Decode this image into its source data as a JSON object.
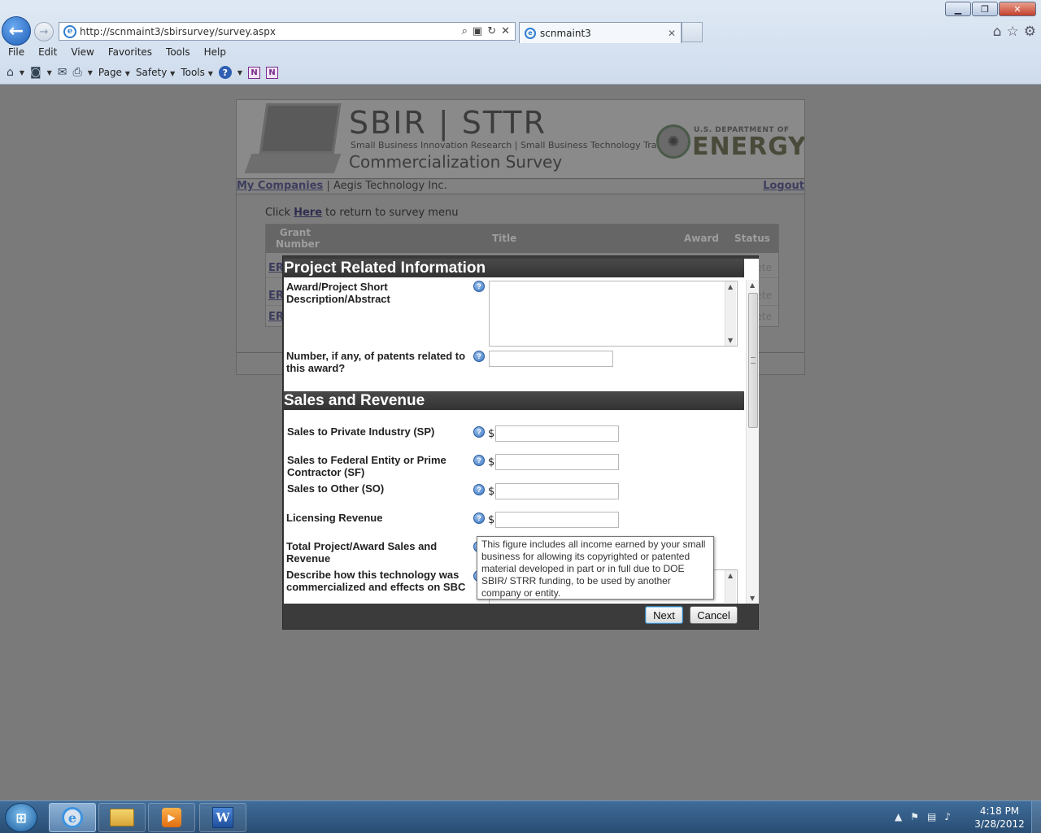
{
  "browser": {
    "url": "http://scnmaint3/sbirsurvey/survey.aspx",
    "tab_title": "scnmaint3",
    "menu": [
      "File",
      "Edit",
      "View",
      "Favorites",
      "Tools",
      "Help"
    ],
    "command_bar": {
      "page": "Page",
      "safety": "Safety",
      "tools": "Tools"
    },
    "window_controls": {
      "minimize": "▁",
      "maximize": "❐",
      "close": "✕"
    }
  },
  "banner": {
    "title": "SBIR | STTR",
    "subtitle": "Small Business Innovation Research | Small Business Technology Transfer",
    "survey": "Commercialization Survey",
    "doe_small": "U.S. DEPARTMENT OF",
    "doe_big": "ENERGY"
  },
  "company_bar": {
    "my_companies": "My Companies",
    "separator": " | ",
    "company_name": "Aegis Technology Inc.",
    "logout": "Logout"
  },
  "return_line": {
    "prefix": "Click ",
    "link": "Here",
    "suffix": " to return to survey menu"
  },
  "grant_table": {
    "headers": {
      "grant": "Grant Number",
      "title": "Title",
      "award": "Award",
      "status": "Status"
    },
    "rows": [
      {
        "grant": "ER",
        "status": "ete"
      },
      {
        "grant": "ER",
        "status": "lete"
      },
      {
        "grant": "ER",
        "status": "lete"
      }
    ]
  },
  "modal": {
    "section1_title": "Project Related Information",
    "award_desc_label": "Award/Project Short Description/Abstract",
    "patents_label": "Number, if any, of patents related to this award?",
    "section2_title": "Sales and Revenue",
    "currency": "$",
    "sales_private_label": "Sales to Private Industry (SP)",
    "sales_federal_label": "Sales to Federal Entity or Prime Contractor (SF)",
    "sales_other_label": "Sales to Other (SO)",
    "licensing_label": "Licensing Revenue",
    "total_label": "Total Project/Award Sales and Revenue",
    "describe_label": "Describe how this technology was commercialized and effects on SBC",
    "help_glyph": "?",
    "tooltip": "This figure includes all income earned by your small business for allowing its copyrighted or patented material developed in part or in full due to DOE SBIR/ STRR funding, to be used by another company or entity.",
    "next_button": "Next",
    "cancel_button": "Cancel"
  },
  "taskbar": {
    "time": "4:18 PM",
    "date": "3/28/2012"
  }
}
